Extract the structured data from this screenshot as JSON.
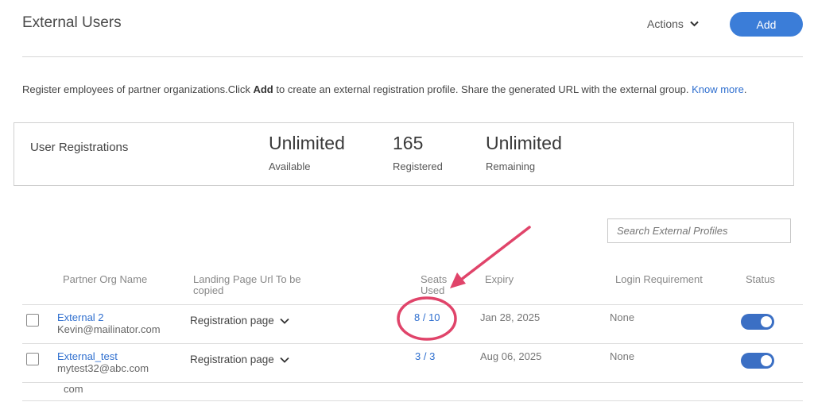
{
  "header": {
    "title": "External Users",
    "actions_label": "Actions",
    "add_label": "Add"
  },
  "description": {
    "prefix": "Register employees of partner organizations.Click ",
    "bold": "Add",
    "middle": " to create an external registration profile. Share the generated URL with the external group. ",
    "link": "Know more",
    "suffix": "."
  },
  "registrations": {
    "title": "User Registrations",
    "stats": [
      {
        "value": "Unlimited",
        "label": "Available"
      },
      {
        "value": "165",
        "label": "Registered"
      },
      {
        "value": "Unlimited",
        "label": "Remaining"
      }
    ]
  },
  "search": {
    "placeholder": "Search External Profiles"
  },
  "table": {
    "columns": {
      "partner": "Partner Org Name",
      "landing": "Landing Page Url To be copied",
      "seats": "Seats Used",
      "expiry": "Expiry",
      "login": "Login Requirement",
      "status": "Status"
    },
    "rows": [
      {
        "name": "External 2",
        "email": "Kevin@mailinator.com",
        "landing": "Registration page",
        "seats": "8 / 10",
        "expiry": "Jan 28, 2025",
        "login": "None",
        "status_on": true
      },
      {
        "name": "External_test",
        "email": "mytest32@abc.com",
        "landing": "Registration page",
        "seats": "3 / 3",
        "expiry": "Aug 06, 2025",
        "login": "None",
        "status_on": true
      }
    ],
    "overflow_text": "com"
  },
  "colors": {
    "accent": "#3b7dd8",
    "link": "#2f6fcf",
    "annotation": "#e0446a",
    "toggle_on": "#3b6fc4"
  },
  "icons": {
    "dropdown": "chevron-down-icon"
  }
}
